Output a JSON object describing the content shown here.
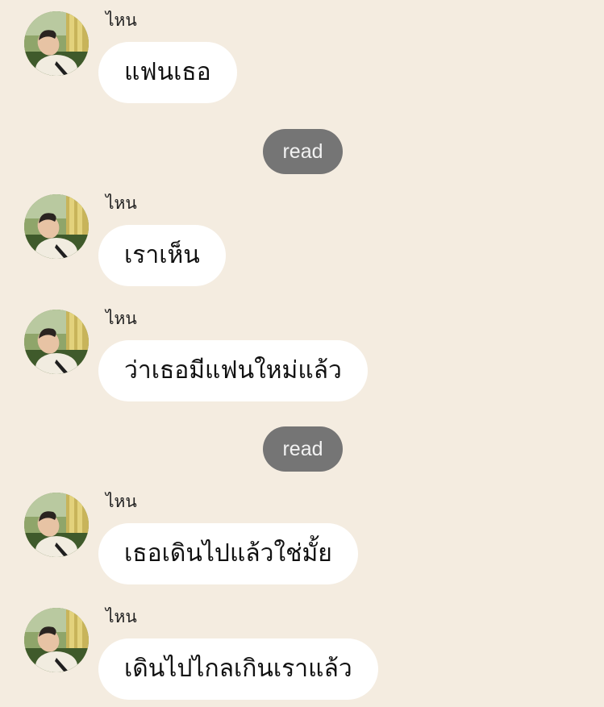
{
  "chat": {
    "messages": [
      {
        "sender": "ไหน",
        "text": "แฟนเธอ"
      },
      {
        "sender": "ไหน",
        "text": "เราเห็น"
      },
      {
        "sender": "ไหน",
        "text": "ว่าเธอมีแฟนใหม่แล้ว"
      },
      {
        "sender": "ไหน",
        "text": "เธอเดินไปแล้วใช่มั้ย"
      },
      {
        "sender": "ไหน",
        "text": "เดินไปไกลเกินเราแล้ว"
      }
    ],
    "read_receipts": [
      "read",
      "read"
    ]
  },
  "colors": {
    "background": "#f4ece0",
    "bubble": "#ffffff",
    "read_badge": "#757575"
  },
  "icons": {
    "avatar": "avatar-photo"
  }
}
